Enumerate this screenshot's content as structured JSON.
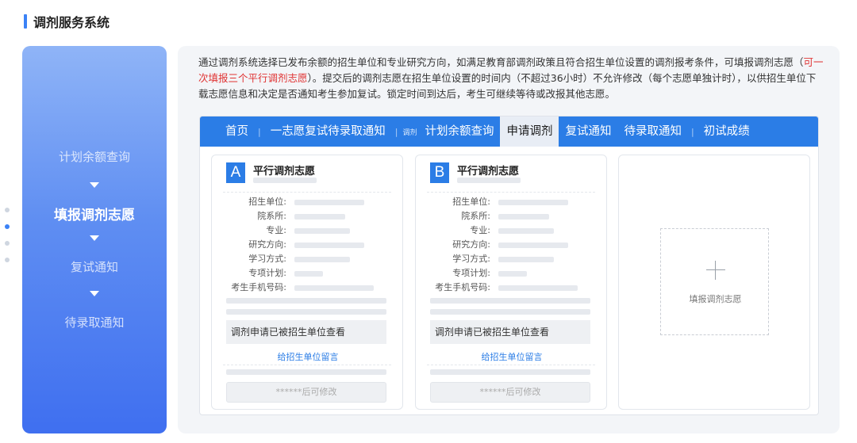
{
  "header": {
    "title": "调剂服务系统"
  },
  "steps": [
    "计划余额查询",
    "填报调剂志愿",
    "复试通知",
    "待录取通知"
  ],
  "intro": {
    "text_before": "通过调剂系统选择已发布余额的招生单位和专业研究方向，如满足教育部调剂政策且符合招生单位设置的调剂报考条件，可填报调剂志愿（",
    "highlight": "可一次填报三个平行调剂志愿",
    "text_after": "）。提交后的调剂志愿在招生单位设置的时间内（不超过36小时）不允许修改（每个志愿单独计时），以供招生单位下载志愿信息和决定是否通知考生参加复试。锁定时间到达后，考生可继续等待或改报其他志愿。"
  },
  "nav": {
    "home": "首页",
    "first_choice": "一志愿复试待录取通知",
    "tiny": "调剂",
    "quota": "计划余额查询",
    "apply": "申请调剂",
    "retest": "复试通知",
    "pending": "待录取通知",
    "scores": "初试成绩"
  },
  "cards": [
    {
      "letter": "A",
      "title": "平行调剂志愿",
      "fields": [
        "招生单位:",
        "院系所:",
        "专业:",
        "研究方向:",
        "学习方式:",
        "专项计划:",
        "考生手机号码:"
      ],
      "status": "调剂申请已被招生单位查看",
      "message_link": "给招生单位留言",
      "modify": "******后可修改"
    },
    {
      "letter": "B",
      "title": "平行调剂志愿",
      "fields": [
        "招生单位:",
        "院系所:",
        "专业:",
        "研究方向:",
        "学习方式:",
        "专项计划:",
        "考生手机号码:"
      ],
      "status": "调剂申请已被招生单位查看",
      "message_link": "给招生单位留言",
      "modify": "******后可修改"
    }
  ],
  "add_card": {
    "label": "填报调剂志愿",
    "icon": "plus-icon"
  },
  "colors": {
    "accent": "#2b7de6",
    "highlight": "#e03232"
  }
}
